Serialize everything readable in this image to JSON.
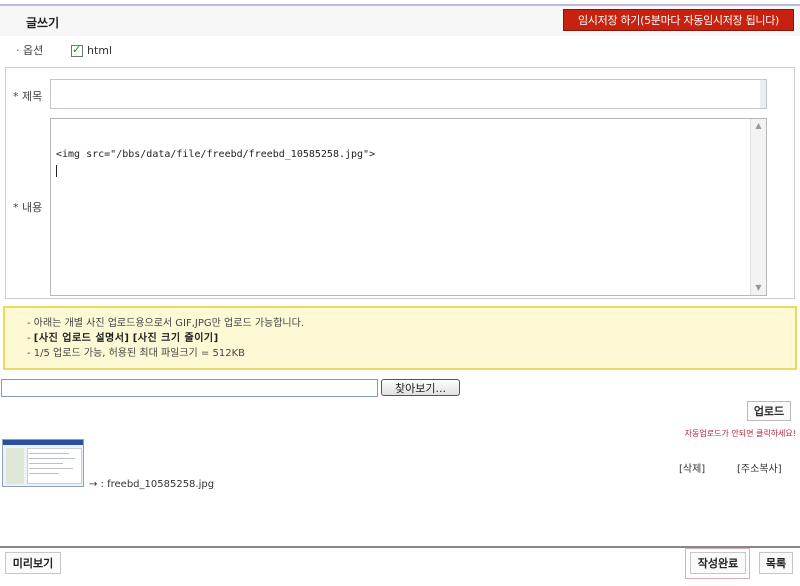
{
  "header": {
    "title": "글쓰기",
    "autosave_button": "임시저장 하기(5분마다 자동임시저장 됩니다)"
  },
  "options": {
    "label": "· 옵션",
    "html_checkbox_label": "html",
    "html_checked": true
  },
  "form": {
    "subject_label": "* 제목",
    "subject_value": "",
    "content_label": "* 내용",
    "content_value": "<img src=\"/bbs/data/file/freebd/freebd_10585258.jpg\">"
  },
  "notice": {
    "line1": "- 아래는 개별 사진 업로드용으로서 GIF,JPG만 업로드 가능합니다.",
    "line2_prefix": "- ",
    "line2_link1": "[사진 업로드 설명서]",
    "line2_link2": "[사진 크기 줄이기]",
    "line3": "- 1/5 업로드 가능, 허용된 최대 파일크기 = 512KB"
  },
  "upload": {
    "file_value": "",
    "browse_button": "찾아보기...",
    "upload_button": "업로드",
    "upload_note": "자동업로드가 안되면 클릭하세요!"
  },
  "attachment": {
    "file_name": "→ : freebd_10585258.jpg",
    "delete_link": "[삭제]",
    "copy_link": "[주소복사]"
  },
  "actions": {
    "preview_button": "미리보기",
    "submit_button": "작성완료",
    "list_button": "목록"
  },
  "colors": {
    "autosave_bg": "#c7210f",
    "notice_bg": "#fdf9d4",
    "notice_border": "#eed85e",
    "checkbox_check": "#1b8a1b"
  }
}
